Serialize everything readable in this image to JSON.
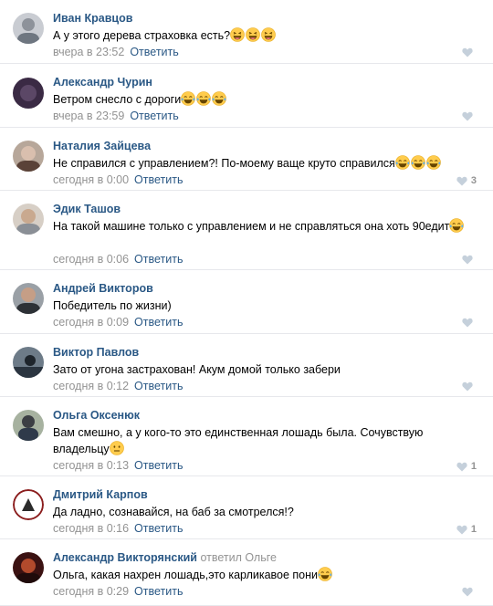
{
  "comments": [
    {
      "author": "Иван Кравцов",
      "text": "А у этого дерева страховка есть?",
      "emojis": [
        "laugh-emoji",
        "laugh-emoji",
        "laugh-emoji"
      ],
      "time": "вчера в 23:52",
      "reply_label": "Ответить",
      "likes": ""
    },
    {
      "author": "Александр Чурин",
      "text": "Ветром снесло с дороги",
      "emojis": [
        "tears-emoji",
        "tears-emoji",
        "tears-emoji"
      ],
      "time": "вчера в 23:59",
      "reply_label": "Ответить",
      "likes": ""
    },
    {
      "author": "Наталия Зайцева",
      "text": "Не справился с управлением?! По-моему ваще круто справился",
      "emojis": [
        "tears-emoji",
        "tears-emoji",
        "tears-emoji"
      ],
      "time": "сегодня в 0:00",
      "reply_label": "Ответить",
      "likes": "3"
    },
    {
      "author": "Эдик Ташов",
      "text": "На такой машине только с управлением и не справляться она хоть 90едит",
      "emojis": [
        "tears-emoji"
      ],
      "time": "сегодня в 0:06",
      "reply_label": "Ответить",
      "likes": ""
    },
    {
      "author": "Андрей Викторов",
      "text": "Победитель по жизни)",
      "emojis": [],
      "time": "сегодня в 0:09",
      "reply_label": "Ответить",
      "likes": ""
    },
    {
      "author": "Виктор Павлов",
      "text": "Зато от угона застрахован! Акум домой только забери",
      "emojis": [],
      "time": "сегодня в 0:12",
      "reply_label": "Ответить",
      "likes": ""
    },
    {
      "author": "Ольга Оксенюк",
      "text": "Вам смешно, а у кого-то это единственная лошадь была. Сочувствую владельцу",
      "emojis": [
        "neutral-emoji"
      ],
      "time": "сегодня в 0:13",
      "reply_label": "Ответить",
      "likes": "1"
    },
    {
      "author": "Дмитрий Карпов",
      "text": "Да ладно, сознавайся, на баб за смотрелся!?",
      "emojis": [],
      "time": "сегодня в 0:16",
      "reply_label": "Ответить",
      "likes": "1"
    },
    {
      "author": "Александр Викторянский",
      "reply_note": "ответил Ольге",
      "text": "Ольга, какая нахрен лошадь,это карликавое пони",
      "emojis": [
        "tears-emoji"
      ],
      "time": "сегодня в 0:29",
      "reply_label": "Ответить",
      "likes": ""
    }
  ]
}
